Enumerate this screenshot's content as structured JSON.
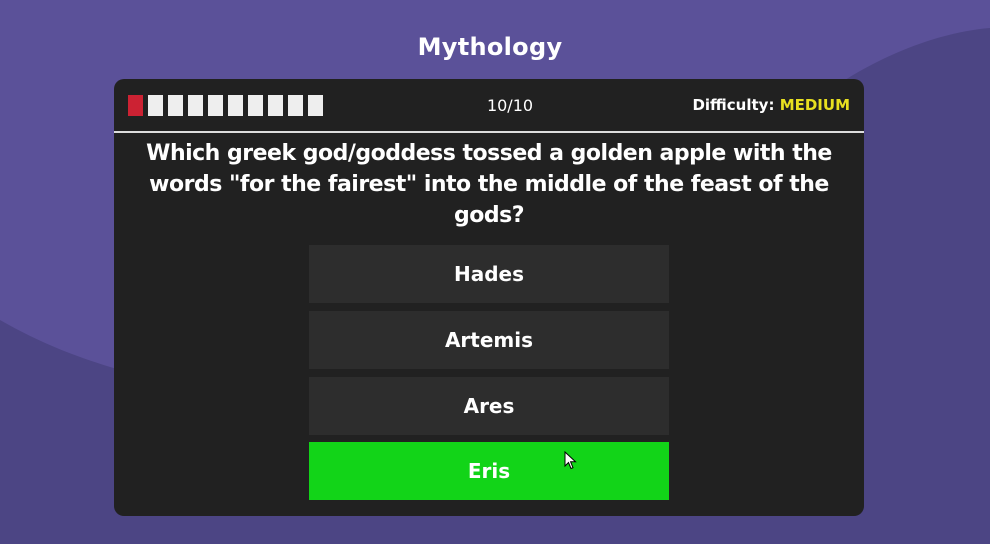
{
  "category": "Mythology",
  "progress": {
    "counter": "10/10",
    "segments": 10,
    "current_segment": 1
  },
  "difficulty": {
    "label": "Difficulty:",
    "value": "MEDIUM"
  },
  "question": {
    "text": "Which greek god/goddess tossed a golden apple with the words \"for the fairest\" into the middle of the feast of the gods?"
  },
  "answers": [
    {
      "label": "Hades"
    },
    {
      "label": "Artemis"
    },
    {
      "label": "Ares"
    },
    {
      "label": "Eris",
      "state": "correct"
    }
  ],
  "colors": {
    "background": "#5b5199",
    "card": "#212121",
    "answer": "#2d2d2d",
    "correct": "#12d418",
    "current_segment": "#cc2233",
    "difficulty_value": "#e8e020"
  }
}
